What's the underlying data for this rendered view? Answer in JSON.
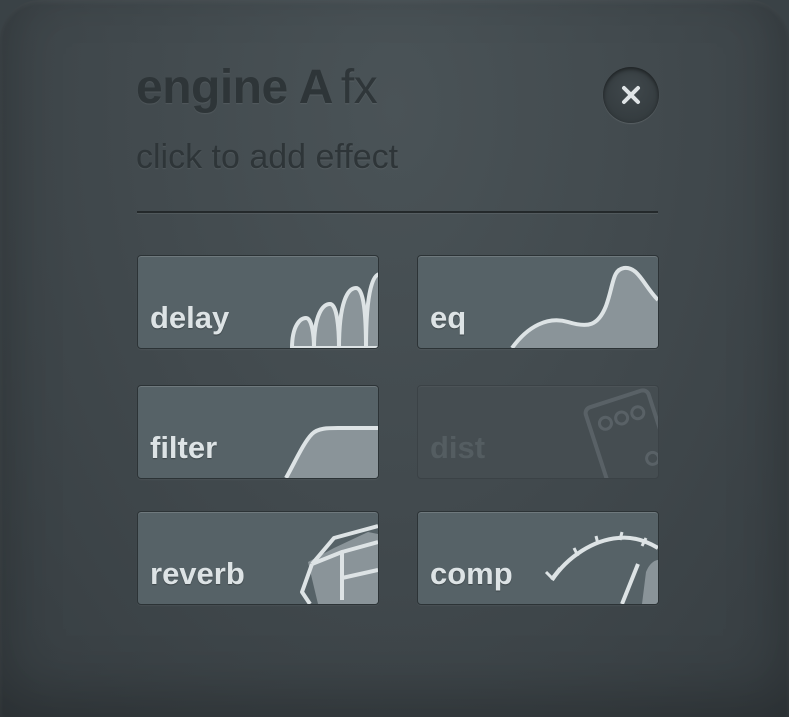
{
  "header": {
    "title_strong": "engine A",
    "title_light": "fx",
    "subtitle": "click to add effect"
  },
  "close_button": {
    "icon": "close-icon",
    "symbol": "×"
  },
  "effects": [
    {
      "id": "delay",
      "label": "delay",
      "icon": "delay-waves-icon",
      "enabled": true
    },
    {
      "id": "eq",
      "label": "eq",
      "icon": "eq-curve-icon",
      "enabled": true
    },
    {
      "id": "filter",
      "label": "filter",
      "icon": "filter-curve-icon",
      "enabled": true
    },
    {
      "id": "dist",
      "label": "dist",
      "icon": "distortion-pedal-icon",
      "enabled": false
    },
    {
      "id": "reverb",
      "label": "reverb",
      "icon": "reverb-cube-icon",
      "enabled": true
    },
    {
      "id": "comp",
      "label": "comp",
      "icon": "compressor-meter-icon",
      "enabled": true
    }
  ],
  "colors": {
    "tile": "#566267",
    "tile_disabled": "#454d51",
    "icon_stroke": "#dde3e5",
    "icon_fill": "#8a9499"
  }
}
